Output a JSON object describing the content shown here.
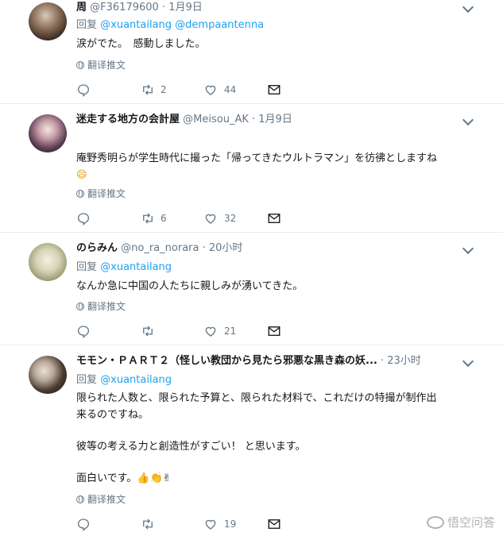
{
  "tweets": [
    {
      "name": "周",
      "handle": "@F36179600",
      "time": "· 1月9日",
      "reply_label": "回复",
      "reply_to": "@xuantailang @dempaantenna",
      "lines": [
        "涙がでた。　感動しました。"
      ],
      "translate": "翻译推文",
      "retweets": "2",
      "likes": "44"
    },
    {
      "name": "迷走する地方の会計屋",
      "handle": "@Meisou_AK",
      "time": "· 1月9日",
      "lines": [
        "庵野秀明らが学生時代に撮った「帰ってきたウルトラマン」を彷彿としますね",
        "😄"
      ],
      "translate": "翻译推文",
      "retweets": "6",
      "likes": "32"
    },
    {
      "name": "のらみん",
      "handle": "@no_ra_norara",
      "time": "· 20小时",
      "reply_label": "回复",
      "reply_to": "@xuantailang",
      "lines": [
        "なんか急に中国の人たちに親しみが湧いてきた。"
      ],
      "translate": "翻译推文",
      "retweets": "",
      "likes": "21"
    },
    {
      "name": "モモン・ＰＡＲＴ２（怪しい教団から見たら邪悪な黒き森の妖...",
      "handle": "",
      "time": "· 23小时",
      "reply_label": "回复",
      "reply_to": "@xuantailang",
      "lines": [
        "限られた人数と、限られた予算と、限られた材料で、これだけの特撮が制作出",
        "来るのですね。",
        "",
        "彼等の考える力と創造性がすごい！ と思います。",
        "",
        "面白いです。👍👏✌"
      ],
      "translate": "翻译推文",
      "retweets": "",
      "likes": "19"
    }
  ],
  "watermark": "悟空问答",
  "icons": {
    "reply": "reply-icon",
    "retweet": "retweet-icon",
    "like": "heart-icon",
    "dm": "envelope-icon",
    "caret": "chevron-down-icon",
    "translate": "globe-icon"
  },
  "colors": {
    "link": "#1da1f2",
    "meta": "#657786",
    "text": "#14171a",
    "divider": "#e6ecf0"
  }
}
